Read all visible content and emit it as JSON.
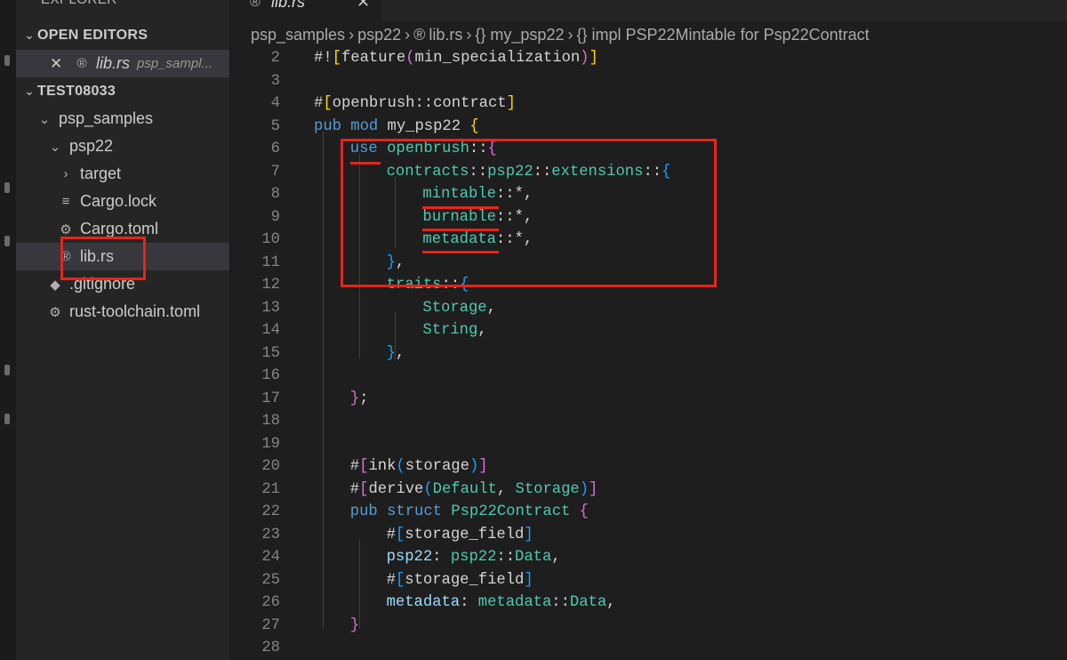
{
  "explorer": {
    "title": "EXPLORER",
    "open_editors_label": "OPEN EDITORS",
    "open_editor_file": "lib.rs",
    "open_editor_path": "psp_sampl...",
    "workspace_label": "TEST08033",
    "tree": [
      {
        "label": "psp_samples",
        "indent": 1,
        "kind": "folder-open"
      },
      {
        "label": "psp22",
        "indent": 2,
        "kind": "folder-open"
      },
      {
        "label": "target",
        "indent": 3,
        "kind": "folder-closed"
      },
      {
        "label": "Cargo.lock",
        "indent": 3,
        "kind": "lock"
      },
      {
        "label": "Cargo.toml",
        "indent": 3,
        "kind": "gear"
      },
      {
        "label": "lib.rs",
        "indent": 3,
        "kind": "rust",
        "selected": true
      },
      {
        "label": ".gitignore",
        "indent": 2,
        "kind": "git"
      },
      {
        "label": "rust-toolchain.toml",
        "indent": 2,
        "kind": "gear"
      }
    ]
  },
  "tab": {
    "label": "lib.rs",
    "close": "✕"
  },
  "breadcrumb": [
    "psp_samples",
    "psp22",
    "lib.rs",
    "{} my_psp22",
    "{} impl PSP22Mintable for Psp22Contract"
  ],
  "breadcrumb_sep": "›",
  "code_lines": [
    {
      "n": "2",
      "indent": 0,
      "tokens": [
        [
          "w",
          "#"
        ],
        [
          "w",
          "!"
        ],
        [
          "y",
          "["
        ],
        [
          "w",
          "feature"
        ],
        [
          "p",
          "("
        ],
        [
          "w",
          "min_specialization"
        ],
        [
          "p",
          ")"
        ],
        [
          "y",
          "]"
        ]
      ]
    },
    {
      "n": "3",
      "indent": 0,
      "tokens": []
    },
    {
      "n": "4",
      "indent": 0,
      "tokens": [
        [
          "w",
          "#"
        ],
        [
          "y",
          "["
        ],
        [
          "w",
          "openbrush::contract"
        ],
        [
          "y",
          "]"
        ]
      ]
    },
    {
      "n": "5",
      "indent": 0,
      "tokens": [
        [
          "k",
          "pub "
        ],
        [
          "k",
          "mod "
        ],
        [
          "w",
          "my_psp22 "
        ],
        [
          "y",
          "{"
        ]
      ]
    },
    {
      "n": "6",
      "indent": 1,
      "tokens": [
        [
          "k",
          "use "
        ],
        [
          "n",
          "openbrush"
        ],
        [
          "w",
          "::"
        ],
        [
          "p",
          "{"
        ]
      ]
    },
    {
      "n": "7",
      "indent": 2,
      "tokens": [
        [
          "n",
          "contracts"
        ],
        [
          "w",
          "::"
        ],
        [
          "n",
          "psp22"
        ],
        [
          "w",
          "::"
        ],
        [
          "n",
          "extensions"
        ],
        [
          "w",
          "::"
        ],
        [
          "b",
          "{"
        ]
      ]
    },
    {
      "n": "8",
      "indent": 3,
      "tokens": [
        [
          "n",
          "mintable"
        ],
        [
          "w",
          "::*,"
        ]
      ]
    },
    {
      "n": "9",
      "indent": 3,
      "tokens": [
        [
          "n",
          "burnable"
        ],
        [
          "w",
          "::*,"
        ]
      ]
    },
    {
      "n": "10",
      "indent": 3,
      "tokens": [
        [
          "n",
          "metadata"
        ],
        [
          "w",
          "::*,"
        ]
      ]
    },
    {
      "n": "11",
      "indent": 2,
      "tokens": [
        [
          "b",
          "}"
        ],
        [
          "w",
          ","
        ]
      ]
    },
    {
      "n": "12",
      "indent": 2,
      "tokens": [
        [
          "n",
          "traits"
        ],
        [
          "w",
          "::"
        ],
        [
          "b",
          "{"
        ]
      ]
    },
    {
      "n": "13",
      "indent": 3,
      "tokens": [
        [
          "n",
          "Storage"
        ],
        [
          "w",
          ","
        ]
      ]
    },
    {
      "n": "14",
      "indent": 3,
      "tokens": [
        [
          "n",
          "String"
        ],
        [
          "w",
          ","
        ]
      ]
    },
    {
      "n": "15",
      "indent": 2,
      "tokens": [
        [
          "b",
          "}"
        ],
        [
          "w",
          ","
        ]
      ]
    },
    {
      "n": "16",
      "indent": 0,
      "tokens": []
    },
    {
      "n": "17",
      "indent": 1,
      "tokens": [
        [
          "p",
          "}"
        ],
        [
          "w",
          ";"
        ]
      ]
    },
    {
      "n": "18",
      "indent": 0,
      "tokens": []
    },
    {
      "n": "19",
      "indent": 0,
      "tokens": []
    },
    {
      "n": "20",
      "indent": 1,
      "tokens": [
        [
          "w",
          "#"
        ],
        [
          "p",
          "["
        ],
        [
          "w",
          "ink"
        ],
        [
          "b",
          "("
        ],
        [
          "w",
          "storage"
        ],
        [
          "b",
          ")"
        ],
        [
          "p",
          "]"
        ]
      ]
    },
    {
      "n": "21",
      "indent": 1,
      "tokens": [
        [
          "w",
          "#"
        ],
        [
          "p",
          "["
        ],
        [
          "w",
          "derive"
        ],
        [
          "b",
          "("
        ],
        [
          "n",
          "Default"
        ],
        [
          "w",
          ", "
        ],
        [
          "n",
          "Storage"
        ],
        [
          "b",
          ")"
        ],
        [
          "p",
          "]"
        ]
      ]
    },
    {
      "n": "22",
      "indent": 1,
      "tokens": [
        [
          "k",
          "pub "
        ],
        [
          "k",
          "struct "
        ],
        [
          "n",
          "Psp22Contract "
        ],
        [
          "p",
          "{"
        ]
      ]
    },
    {
      "n": "23",
      "indent": 2,
      "tokens": [
        [
          "w",
          "#"
        ],
        [
          "b",
          "["
        ],
        [
          "w",
          "storage_field"
        ],
        [
          "b",
          "]"
        ]
      ]
    },
    {
      "n": "24",
      "indent": 2,
      "tokens": [
        [
          "v",
          "psp22"
        ],
        [
          "w",
          ": "
        ],
        [
          "n",
          "psp22"
        ],
        [
          "w",
          "::"
        ],
        [
          "n",
          "Data"
        ],
        [
          "w",
          ","
        ]
      ]
    },
    {
      "n": "25",
      "indent": 2,
      "tokens": [
        [
          "w",
          "#"
        ],
        [
          "b",
          "["
        ],
        [
          "w",
          "storage_field"
        ],
        [
          "b",
          "]"
        ]
      ]
    },
    {
      "n": "26",
      "indent": 2,
      "tokens": [
        [
          "v",
          "metadata"
        ],
        [
          "w",
          ": "
        ],
        [
          "n",
          "metadata"
        ],
        [
          "w",
          "::"
        ],
        [
          "n",
          "Data"
        ],
        [
          "w",
          ","
        ]
      ]
    },
    {
      "n": "27",
      "indent": 1,
      "tokens": [
        [
          "p",
          "}"
        ]
      ]
    },
    {
      "n": "28",
      "indent": 0,
      "tokens": []
    }
  ]
}
